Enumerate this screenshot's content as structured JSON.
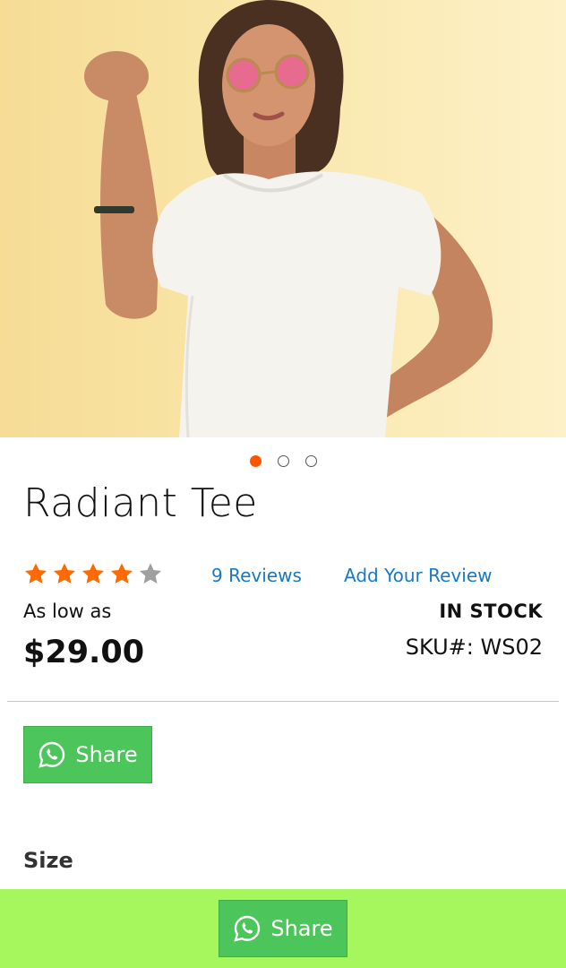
{
  "product": {
    "image_alt": "Woman in white t-shirt and pink sunglasses",
    "carousel": {
      "total": 3,
      "active_index": 0
    },
    "name": "Radiant Tee",
    "rating": {
      "value": 4,
      "max": 5
    },
    "reviews_label": "9 Reviews",
    "add_review_label": "Add Your Review",
    "price_prefix": "As low as",
    "price": "$29.00",
    "stock_status": "IN STOCK",
    "sku": "SKU#: WS02"
  },
  "share": {
    "label": "Share",
    "icon": "whatsapp-icon"
  },
  "options": {
    "size_label": "Size"
  },
  "sticky_share": {
    "label": "Share",
    "icon": "whatsapp-icon"
  },
  "colors": {
    "accent": "#ff5500",
    "star_filled": "#ff6a00",
    "star_empty": "#a0a0a0",
    "link": "#1979c3",
    "share_button": "#4cc65b",
    "sticky_bar": "#a6f75e"
  }
}
